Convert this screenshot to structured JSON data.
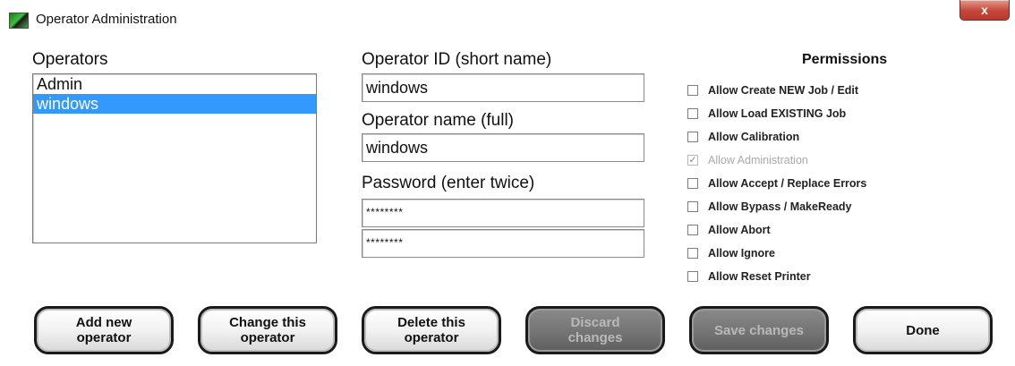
{
  "window": {
    "title": "Operator Administration",
    "close_label": "x"
  },
  "operators": {
    "label": "Operators",
    "items": [
      {
        "name": "Admin",
        "selected": false
      },
      {
        "name": "windows",
        "selected": true
      }
    ]
  },
  "form": {
    "id_label": "Operator ID (short name)",
    "id_value": "windows",
    "name_label": "Operator name (full)",
    "name_value": "windows",
    "password_label": "Password (enter twice)",
    "password1": "********",
    "password2": "********"
  },
  "permissions": {
    "title": "Permissions",
    "items": [
      {
        "label": "Allow Create NEW Job / Edit",
        "checked": false,
        "enabled": true
      },
      {
        "label": "Allow Load EXISTING Job",
        "checked": false,
        "enabled": true
      },
      {
        "label": "Allow Calibration",
        "checked": false,
        "enabled": true
      },
      {
        "label": "Allow Administration",
        "checked": true,
        "enabled": false
      },
      {
        "label": "Allow Accept / Replace Errors",
        "checked": false,
        "enabled": true
      },
      {
        "label": "Allow Bypass / MakeReady",
        "checked": false,
        "enabled": true
      },
      {
        "label": "Allow Abort",
        "checked": false,
        "enabled": true
      },
      {
        "label": "Allow Ignore",
        "checked": false,
        "enabled": true
      },
      {
        "label": "Allow Reset Printer",
        "checked": false,
        "enabled": true
      }
    ]
  },
  "buttons": {
    "add": "Add new\noperator",
    "change": "Change this\noperator",
    "delete": "Delete this\noperator",
    "discard": "Discard\nchanges",
    "save": "Save changes",
    "done": "Done"
  }
}
